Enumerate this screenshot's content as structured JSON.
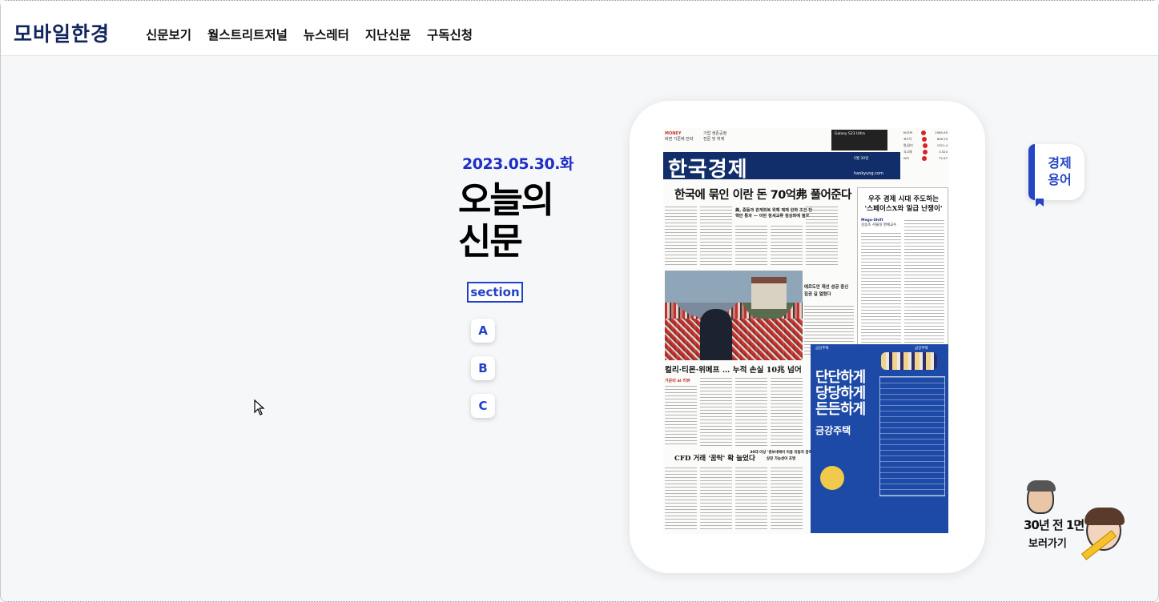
{
  "header": {
    "logo": "모바일한경",
    "nav": [
      "신문보기",
      "월스트리트저널",
      "뉴스레터",
      "지난신문",
      "구독신청"
    ]
  },
  "main": {
    "date": "2023.05.30.화",
    "title_line1": "오늘의",
    "title_line2": "신문",
    "section_label": "section",
    "sections": [
      "A",
      "B",
      "C"
    ]
  },
  "paper": {
    "masthead": "한국경제",
    "masthead_web": "hankyung.com",
    "masthead_date": "5월 30일",
    "top_left": "MONEY",
    "top_left_sub": "바뀐 기준에 전략",
    "top_mid": "기업 생존공정",
    "top_mid_sub": "전문 및 취재",
    "top_ad": "Galaxy S23 Ultra",
    "market": [
      {
        "name": "KOSPI",
        "value": "2585.95"
      },
      {
        "name": "코스닥",
        "value": "856.20"
      },
      {
        "name": "원/달러",
        "value": "1321.4"
      },
      {
        "name": "국고채",
        "value": "3.520"
      },
      {
        "name": "WTI",
        "value": "72.67"
      }
    ],
    "headline": "한국에 묶인 이란 돈 70억弗 풀어준다",
    "subhead": "美, 중동과 관계회복 위해 제재 완화 조건 탄핵안 통과 — 이란 정세교류 정상화에 필요",
    "box_title_1": "우주 경제 시대 주도하는",
    "box_title_2": "'스페이스X와 일급 난쟁이'",
    "box_tag": "Mega-Shift",
    "box_tag_sub": "김승조 서울대 명예교수",
    "photo_caption": "에르도안 재선 성공 종신 집권 길 열렸다",
    "caption2": "컬리·티몬·위메프 … 누적 손실 10兆 넘어",
    "brand": "거문비 ai 리뷰",
    "cfd": "CFD 거래 '꿈탁' 확 늘었다",
    "cfd_sub": "30대 이상 '쌍보네에이 이용 유동자 감축 상장 가능성이 조명",
    "ad_left": "금강주택",
    "ad_right": "금강주택",
    "ad_big": "단단하게\n당당하게\n든든하게",
    "ad_product": "금강주택"
  },
  "widgets": {
    "term_line1": "경제",
    "term_line2": "용어",
    "throwback_line1": "30년 전 1면",
    "throwback_line2": "보러가기"
  },
  "colors": {
    "brand_navy": "#12255e",
    "accent_blue": "#2241c9",
    "masthead": "#122e6a",
    "ad_blue": "#1d4aa7"
  }
}
